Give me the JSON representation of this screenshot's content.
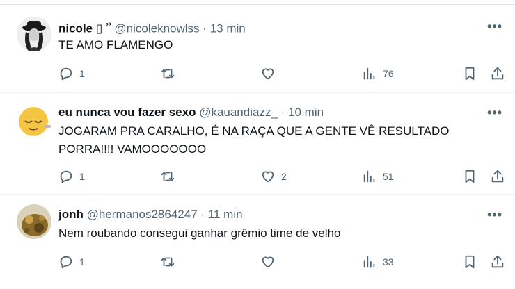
{
  "tweets": [
    {
      "name": "nicole",
      "name_emoji": "▯",
      "name_badge": "³⁰",
      "handle": "@nicoleknowlss",
      "dot": "·",
      "time": "13 min",
      "text": "TE AMO FLAMENGO",
      "replies": "1",
      "retweets": "",
      "likes": "",
      "views": "76",
      "more": "•••"
    },
    {
      "name": "eu nunca vou fazer sexo",
      "handle": "@kauandiazz_",
      "dot": "·",
      "time": "10 min",
      "text_line1": "JOGARAM PRA CARALHO, É NA RAÇA QUE A GENTE VÊ RESULTADO",
      "text_line2": "PORRA!!!! VAMOOOOOOO",
      "replies": "1",
      "retweets": "",
      "likes": "2",
      "views": "51",
      "more": "•••"
    },
    {
      "name": "jonh",
      "handle": "@hermanos2864247",
      "dot": "·",
      "time": "11 min",
      "text": "Nem roubando consegui ganhar grêmio time de velho",
      "replies": "1",
      "retweets": "",
      "likes": "",
      "views": "33",
      "more": "•••"
    }
  ],
  "icons": {
    "reply": "reply-icon",
    "retweet": "retweet-icon",
    "like": "heart-icon",
    "views": "views-icon",
    "bookmark": "bookmark-icon",
    "share": "share-icon"
  },
  "colors": {
    "text": "#0f1419",
    "secondary": "#536471",
    "divider": "#eff3f4"
  }
}
